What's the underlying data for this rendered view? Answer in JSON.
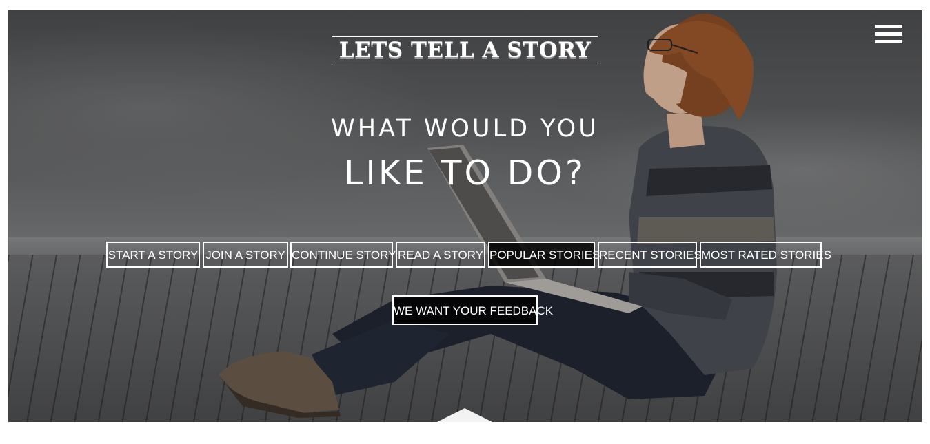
{
  "header": {
    "logo_text": "LETS TELL A STORY",
    "menu_icon": "hamburger-menu-icon"
  },
  "hero": {
    "headline_line1": "WHAT WOULD YOU",
    "headline_line2": "LIKE TO DO?"
  },
  "actions": {
    "start_story": "START A STORY",
    "join_story": "JOIN A STORY",
    "continue_story": "CONTINUE STORY",
    "read_story": "READ A STORY",
    "popular_stories": "POPULAR STORIES",
    "recent_stories": "RECENT STORIES",
    "most_rated_stories": "MOST RATED STORIES",
    "feedback": "WE WANT YOUR FEEDBACK"
  },
  "colors": {
    "button_border": "#ffffff",
    "button_dark_bg": "#111111",
    "page_background": "#ffffff"
  }
}
